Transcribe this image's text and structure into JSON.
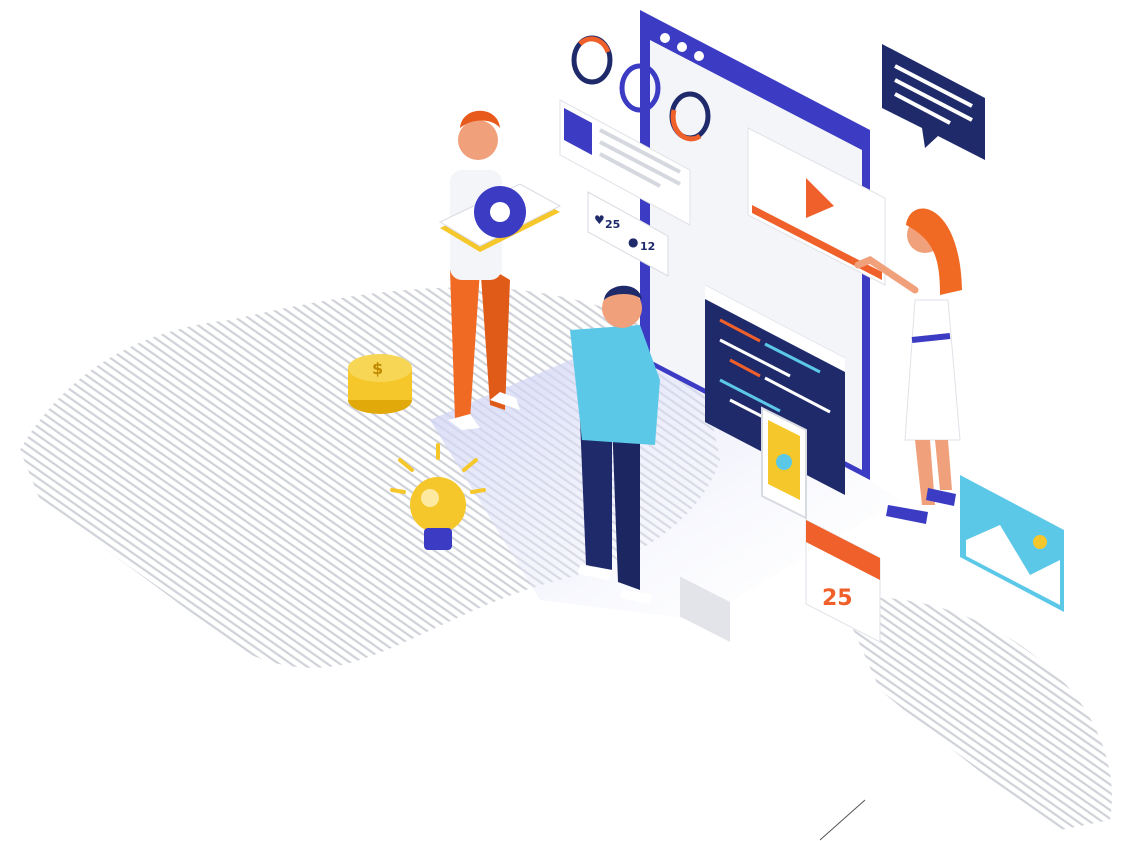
{
  "illustration": {
    "likes_count": "25",
    "comments_count": "12",
    "calendar_day": "25",
    "coin_symbol": "$",
    "icons": [
      "heart-icon",
      "comment-icon",
      "gear-icon",
      "play-icon",
      "lightbulb-icon",
      "dollar-coin-icon",
      "calendar-icon",
      "image-icon",
      "chat-bubble-icon",
      "smartphone-icon",
      "code-window-icon",
      "donut-chart-icon"
    ]
  },
  "colors": {
    "primary_blue": "#3b3bc4",
    "navy": "#1f2a6b",
    "orange": "#f0602a",
    "sky_blue": "#5cc8e8",
    "yellow": "#f5c72a",
    "panel_gray": "#eef0f4"
  }
}
